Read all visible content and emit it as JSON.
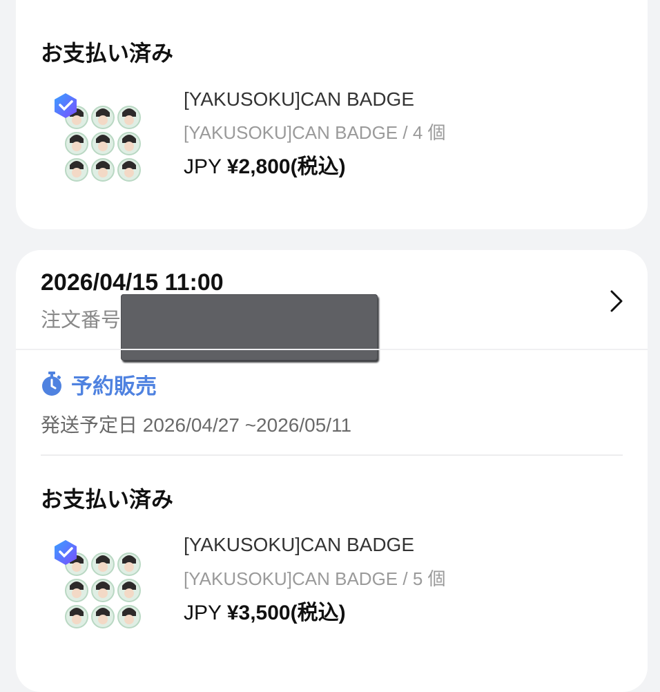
{
  "orders_above": {
    "status": "お支払い済み",
    "item": {
      "title": "[YAKUSOKU]CAN BADGE",
      "option": "[YAKUSOKU]CAN BADGE / 4 個",
      "currency": "JPY",
      "amount": "¥2,800(税込)"
    }
  },
  "order": {
    "datetime": "2026/04/15 11:00",
    "order_number_label": "注文番号",
    "sale_type_icon": "stopwatch-icon",
    "sale_type": "予約販売",
    "shipping": "発送予定日 2026/04/27 ~2026/05/11",
    "status": "お支払い済み",
    "item": {
      "title": "[YAKUSOKU]CAN BADGE",
      "option": "[YAKUSOKU]CAN BADGE / 5 個",
      "currency": "JPY",
      "amount": "¥3,500(税込)"
    }
  },
  "colors": {
    "accent_blue": "#4f82e0",
    "badge_gradient": [
      "#3aa0ff",
      "#7a4dff"
    ],
    "thumb_green": "#cfe7d6"
  }
}
